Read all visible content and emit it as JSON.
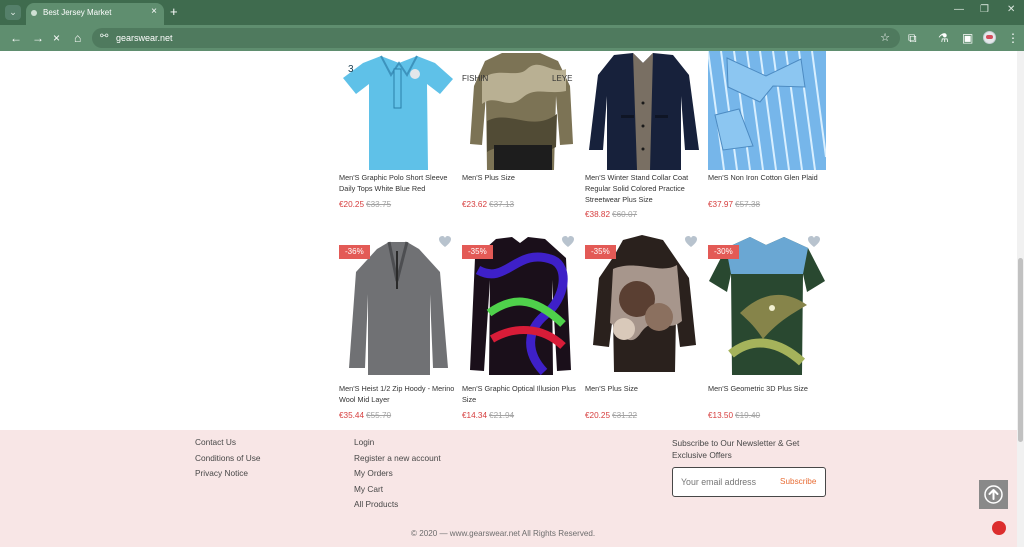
{
  "browser": {
    "tab_title": "Best Jersey Market",
    "url": "gearswear.net",
    "icons": [
      "tab-list-icon",
      "favicon-icon",
      "close-icon",
      "new-tab-icon",
      "back-icon",
      "forward-icon",
      "stop-icon",
      "home-icon",
      "site-info-icon",
      "bookmark-star-icon",
      "extensions-icon",
      "labs-icon",
      "sidebar-icon",
      "profile-avatar",
      "menu-icon"
    ]
  },
  "products_row_1": [
    {
      "title": "Men'S Graphic Polo Short Sleeve Daily Tops White Blue Red",
      "price": "€20.25",
      "old_price": "€33.75"
    },
    {
      "title": "Men'S Plus Size",
      "price": "€23.62",
      "old_price": "€37.13"
    },
    {
      "title": "Men'S Winter Stand Collar Coat Regular Solid Colored Practice Streetwear Plus Size",
      "price": "€38.82",
      "old_price": "€60.07"
    },
    {
      "title": "Men'S Non Iron Cotton Glen Plaid",
      "price": "€37.97",
      "old_price": "€57.38"
    }
  ],
  "products_row_2": [
    {
      "badge": "-36%",
      "title": "Men'S Heist 1/2 Zip Hoody - Merino Wool Mid Layer",
      "price": "€35.44",
      "old_price": "€55.70"
    },
    {
      "badge": "-35%",
      "title": "Men'S Graphic Optical Illusion Plus Size",
      "price": "€14.34",
      "old_price": "€21.94"
    },
    {
      "badge": "-35%",
      "title": "Men'S Plus Size",
      "price": "€20.25",
      "old_price": "€31.22"
    },
    {
      "badge": "-30%",
      "title": "Men'S Geometric 3D Plus Size",
      "price": "€13.50",
      "old_price": "€19.40"
    }
  ],
  "footer": {
    "links_left": [
      "Contact Us",
      "Conditions of Use",
      "Privacy Notice"
    ],
    "links_middle": [
      "Login",
      "Register a new account",
      "My Orders",
      "My Cart",
      "All Products"
    ],
    "newsletter_title": "Subscribe to Our Newsletter & Get Exclusive Offers",
    "email_placeholder": "Your email address",
    "subscribe_label": "Subscribe",
    "copyright": "© 2020 — www.gearswear.net All Rights Reserved."
  },
  "colors": {
    "browser_green": "#5f8e6f",
    "price_red": "#d63d3d",
    "discount_red": "#e35a56",
    "footer_pink": "#f8e6e6",
    "subscribe_orange": "#e86d35"
  }
}
